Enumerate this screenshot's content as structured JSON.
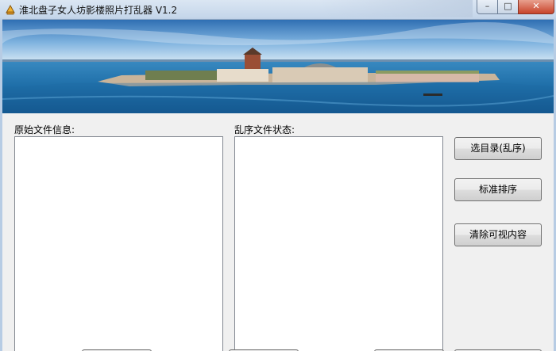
{
  "window": {
    "title": "淮北盘子女人坊影楼照片打乱器 V1.2",
    "controls": {
      "minimize": "–",
      "maximize": "□",
      "close": "✕"
    }
  },
  "left_panel": {
    "label": "原始文件信息:"
  },
  "right_panel": {
    "label": "乱序文件状态:"
  },
  "buttons": {
    "choose_dir": "选目录(乱序)",
    "standard_sort": "标准排序",
    "clear_view": "清除可视内容"
  },
  "colors": {
    "sky": "#5a9bd1",
    "sea": "#1f6fa8",
    "face": "#f0f0f0"
  }
}
